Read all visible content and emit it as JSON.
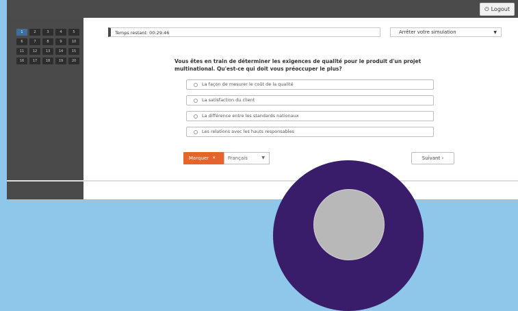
{
  "topbar": {
    "logout_label": "Logout",
    "logout_icon": "power-icon"
  },
  "sidebar": {
    "question_numbers": [
      "1",
      "2",
      "3",
      "4",
      "5",
      "6",
      "7",
      "8",
      "9",
      "10",
      "11",
      "12",
      "13",
      "14",
      "15",
      "16",
      "17",
      "18",
      "19",
      "20"
    ],
    "current_question": "1"
  },
  "main": {
    "time_remaining": "Temps restant: 00:29:46",
    "stop_simulation_label": "Arrêter votre simulation",
    "question_text": "Vous êtes en train de déterminer les exigences de qualité pour le produit d'un projet multinational. Qu'est-ce qui doit vous préoccuper le plus?",
    "answers": [
      "La façon de mesurer le coût de la qualité",
      "La satisfaction du client",
      "La différence entre les standards nationaux",
      "Les relations avec les hauts responsables"
    ],
    "validate_label": "Marquer",
    "language_selected": "Français",
    "next_label": "Suivant"
  },
  "colors": {
    "accent_orange": "#e4642b",
    "sidebar_dark": "#4a4a4a",
    "frame_blue": "#8fc7ea",
    "overlay_purple": "#3a1d6a"
  }
}
